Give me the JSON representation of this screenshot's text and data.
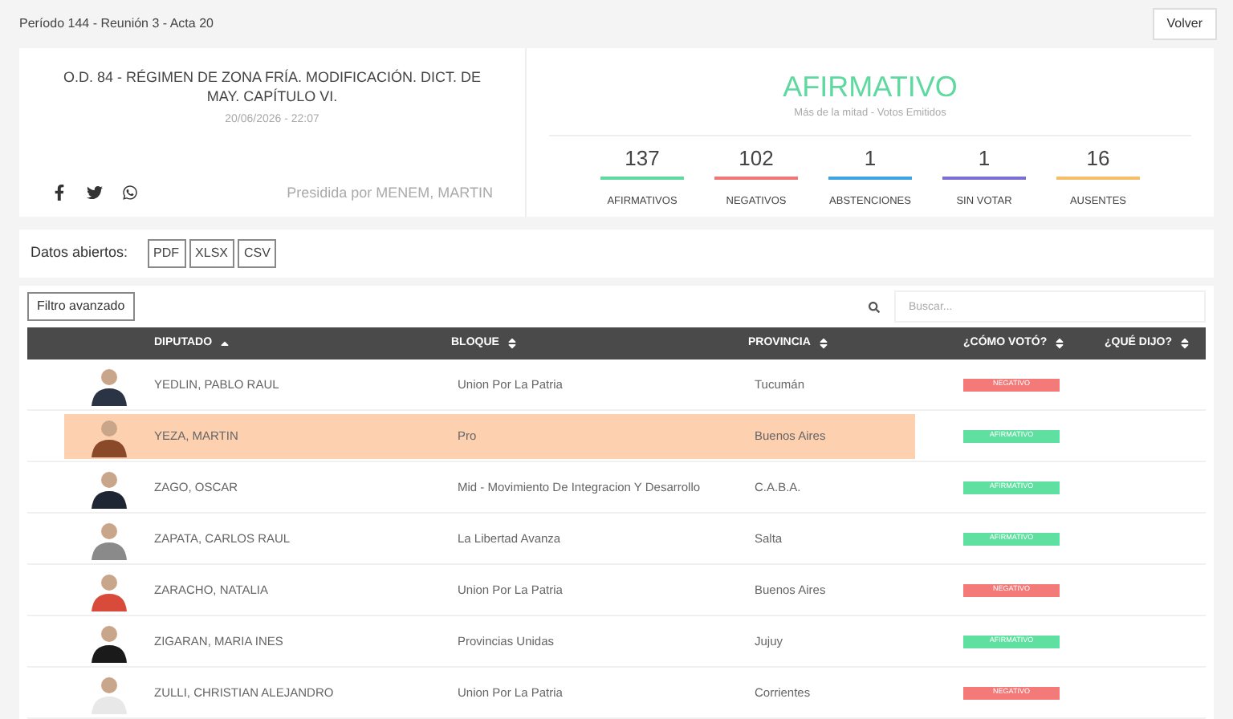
{
  "breadcrumb": "Período 144 - Reunión 3 - Acta 20",
  "back_button": "Volver",
  "vote": {
    "title": "O.D. 84 - RÉGIMEN DE ZONA FRÍA. MODIFICACIÓN. DICT. DE MAY. CAPÍTULO VI.",
    "date": "20/06/2026 - 22:07",
    "presided": "Presidida por MENEM, MARTIN",
    "result": "AFIRMATIVO",
    "majority": "Más de la mitad - Votos Emitidos",
    "counts": [
      {
        "value": "137",
        "label": "AFIRMATIVOS",
        "color": "#5fd9a0"
      },
      {
        "value": "102",
        "label": "NEGATIVOS",
        "color": "#f07777"
      },
      {
        "value": "1",
        "label": "ABSTENCIONES",
        "color": "#3ea3e0"
      },
      {
        "value": "1",
        "label": "SIN VOTAR",
        "color": "#7b6fd6"
      },
      {
        "value": "16",
        "label": "AUSENTES",
        "color": "#f5bf6a"
      }
    ]
  },
  "open_data": {
    "label": "Datos abiertos:",
    "formats": [
      "PDF",
      "XLSX",
      "CSV"
    ]
  },
  "filter_button": "Filtro avanzado",
  "search": {
    "placeholder": "Buscar..."
  },
  "table": {
    "columns": [
      {
        "label": "DIPUTADO",
        "sorted": true
      },
      {
        "label": "BLOQUE",
        "sorted": false
      },
      {
        "label": "PROVINCIA",
        "sorted": false
      },
      {
        "label": "¿CÓMO VOTÓ?",
        "sorted": false
      },
      {
        "label": "¿QUÉ DIJO?",
        "sorted": false
      }
    ],
    "rows": [
      {
        "name": "YEDLIN, PABLO RAUL",
        "bloc": "Union Por La Patria",
        "province": "Tucumán",
        "vote": "NEGATIVO",
        "kind": "negativo",
        "selected": false
      },
      {
        "name": "YEZA, MARTIN",
        "bloc": "Pro",
        "province": "Buenos Aires",
        "vote": "AFIRMATIVO",
        "kind": "afirmativo",
        "selected": true
      },
      {
        "name": "ZAGO, OSCAR",
        "bloc": "Mid - Movimiento De Integracion Y Desarrollo",
        "province": "C.A.B.A.",
        "vote": "AFIRMATIVO",
        "kind": "afirmativo",
        "selected": false
      },
      {
        "name": "ZAPATA, CARLOS RAUL",
        "bloc": "La Libertad Avanza",
        "province": "Salta",
        "vote": "AFIRMATIVO",
        "kind": "afirmativo",
        "selected": false
      },
      {
        "name": "ZARACHO, NATALIA",
        "bloc": "Union Por La Patria",
        "province": "Buenos Aires",
        "vote": "NEGATIVO",
        "kind": "negativo",
        "selected": false
      },
      {
        "name": "ZIGARAN, MARIA INES",
        "bloc": "Provincias Unidas",
        "province": "Jujuy",
        "vote": "AFIRMATIVO",
        "kind": "afirmativo",
        "selected": false
      },
      {
        "name": "ZULLI, CHRISTIAN ALEJANDRO",
        "bloc": "Union Por La Patria",
        "province": "Corrientes",
        "vote": "NEGATIVO",
        "kind": "negativo",
        "selected": false
      }
    ]
  }
}
